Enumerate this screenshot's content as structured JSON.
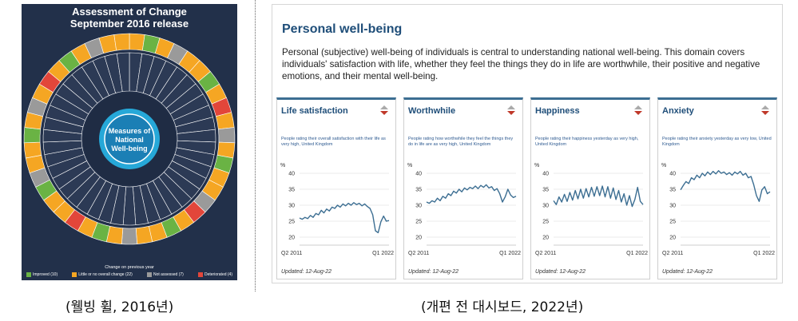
{
  "wheel": {
    "title_line1": "Assessment of Change",
    "title_line2": "September 2016 release",
    "center_label": "Measures of National Well-being",
    "legend_title": "Change on previous year",
    "legend": [
      {
        "label": "Improved (10)",
        "color": "#6ab344"
      },
      {
        "label": "Little or no overall change (22)",
        "color": "#f5a623"
      },
      {
        "label": "Not assessed (7)",
        "color": "#9a9a9a"
      },
      {
        "label": "Deteriorated (4)",
        "color": "#e2463a"
      }
    ],
    "colors": {
      "background": "#22304a",
      "center": "#1b7fb5",
      "inner_ring": "#26a8d8"
    }
  },
  "captions": {
    "left": "(웰빙 휠, 2016년)",
    "right": "(개편 전 대시보드, 2022년)"
  },
  "dashboard": {
    "title": "Personal well-being",
    "description": "Personal (subjective) well-being of individuals is central to understanding national well-being. This domain covers individuals' satisfaction with life, whether they feel the things they do in life are worthwhile, their positive and negative emotions, and their mental well-being.",
    "cards": [
      {
        "title": "Life satisfaction",
        "description": "People rating their overall satisfaction with their life as very high, United Kingdom",
        "unit": "%",
        "x_start": "Q2 2011",
        "x_end": "Q1 2022",
        "updated": "Updated: 12-Aug-22",
        "y_ticks": [
          20,
          25,
          30,
          35,
          40
        ],
        "values": [
          26,
          25.6,
          26.2,
          25.8,
          26.8,
          26.2,
          27.4,
          27,
          28.4,
          27.6,
          28.8,
          28.2,
          29.4,
          29,
          30,
          29.4,
          30.4,
          29.8,
          30.6,
          30,
          30.8,
          30.2,
          30.6,
          29.8,
          30.4,
          29.6,
          29,
          27,
          22,
          21.4,
          24.8,
          26.6,
          25,
          25.2
        ]
      },
      {
        "title": "Worthwhile",
        "description": "People rating how worthwhile they feel the things they do in life are as very high, United Kingdom",
        "unit": "%",
        "x_start": "Q2 2011",
        "x_end": "Q1 2022",
        "updated": "Updated: 12-Aug-22",
        "y_ticks": [
          20,
          25,
          30,
          35,
          40
        ],
        "values": [
          31,
          30.6,
          31.4,
          31,
          32.2,
          31.4,
          32.8,
          32.2,
          33.6,
          33,
          34.4,
          33.8,
          35,
          34.2,
          35.4,
          34.8,
          35.6,
          35.2,
          36,
          35.2,
          36.2,
          35.6,
          36.4,
          35.4,
          35.8,
          34.6,
          35.2,
          33.6,
          31,
          32.6,
          35,
          33.2,
          32.4,
          32.8
        ]
      },
      {
        "title": "Happiness",
        "description": "People rating their happiness yesterday as very high, United Kingdom",
        "unit": "%",
        "x_start": "Q2 2011",
        "x_end": "Q1 2022",
        "updated": "Updated: 12-Aug-22",
        "y_ticks": [
          20,
          25,
          30,
          35,
          40
        ],
        "values": [
          31.4,
          30.2,
          32.6,
          31,
          33.4,
          31.2,
          34,
          31.6,
          34.6,
          32,
          35,
          32.2,
          35.2,
          32.6,
          35.6,
          32.8,
          35.8,
          33,
          36,
          32.6,
          35.8,
          32.2,
          35.4,
          31.8,
          34.6,
          31,
          33.6,
          30,
          33,
          29.6,
          31.8,
          35.6,
          31.2,
          30.2
        ]
      },
      {
        "title": "Anxiety",
        "description": "People rating their anxiety yesterday as very low, United Kingdom",
        "unit": "%",
        "x_start": "Q2 2011",
        "x_end": "Q1 2022",
        "updated": "Updated: 12-Aug-22",
        "y_ticks": [
          20,
          25,
          30,
          35,
          40
        ],
        "values": [
          34.8,
          36.2,
          37.4,
          36.8,
          38.6,
          38,
          39.4,
          38.6,
          40,
          39.2,
          40.4,
          39.6,
          40.6,
          39.8,
          40.8,
          40,
          40.4,
          39.6,
          40.2,
          39.4,
          40.4,
          39.8,
          40.6,
          39.4,
          40,
          38.6,
          39,
          36.4,
          33,
          31.2,
          34.8,
          35.8,
          33.6,
          34.2
        ]
      }
    ],
    "colors": {
      "title": "#1f4e79",
      "line": "#3c6e92",
      "accent": "#c0392b"
    }
  }
}
